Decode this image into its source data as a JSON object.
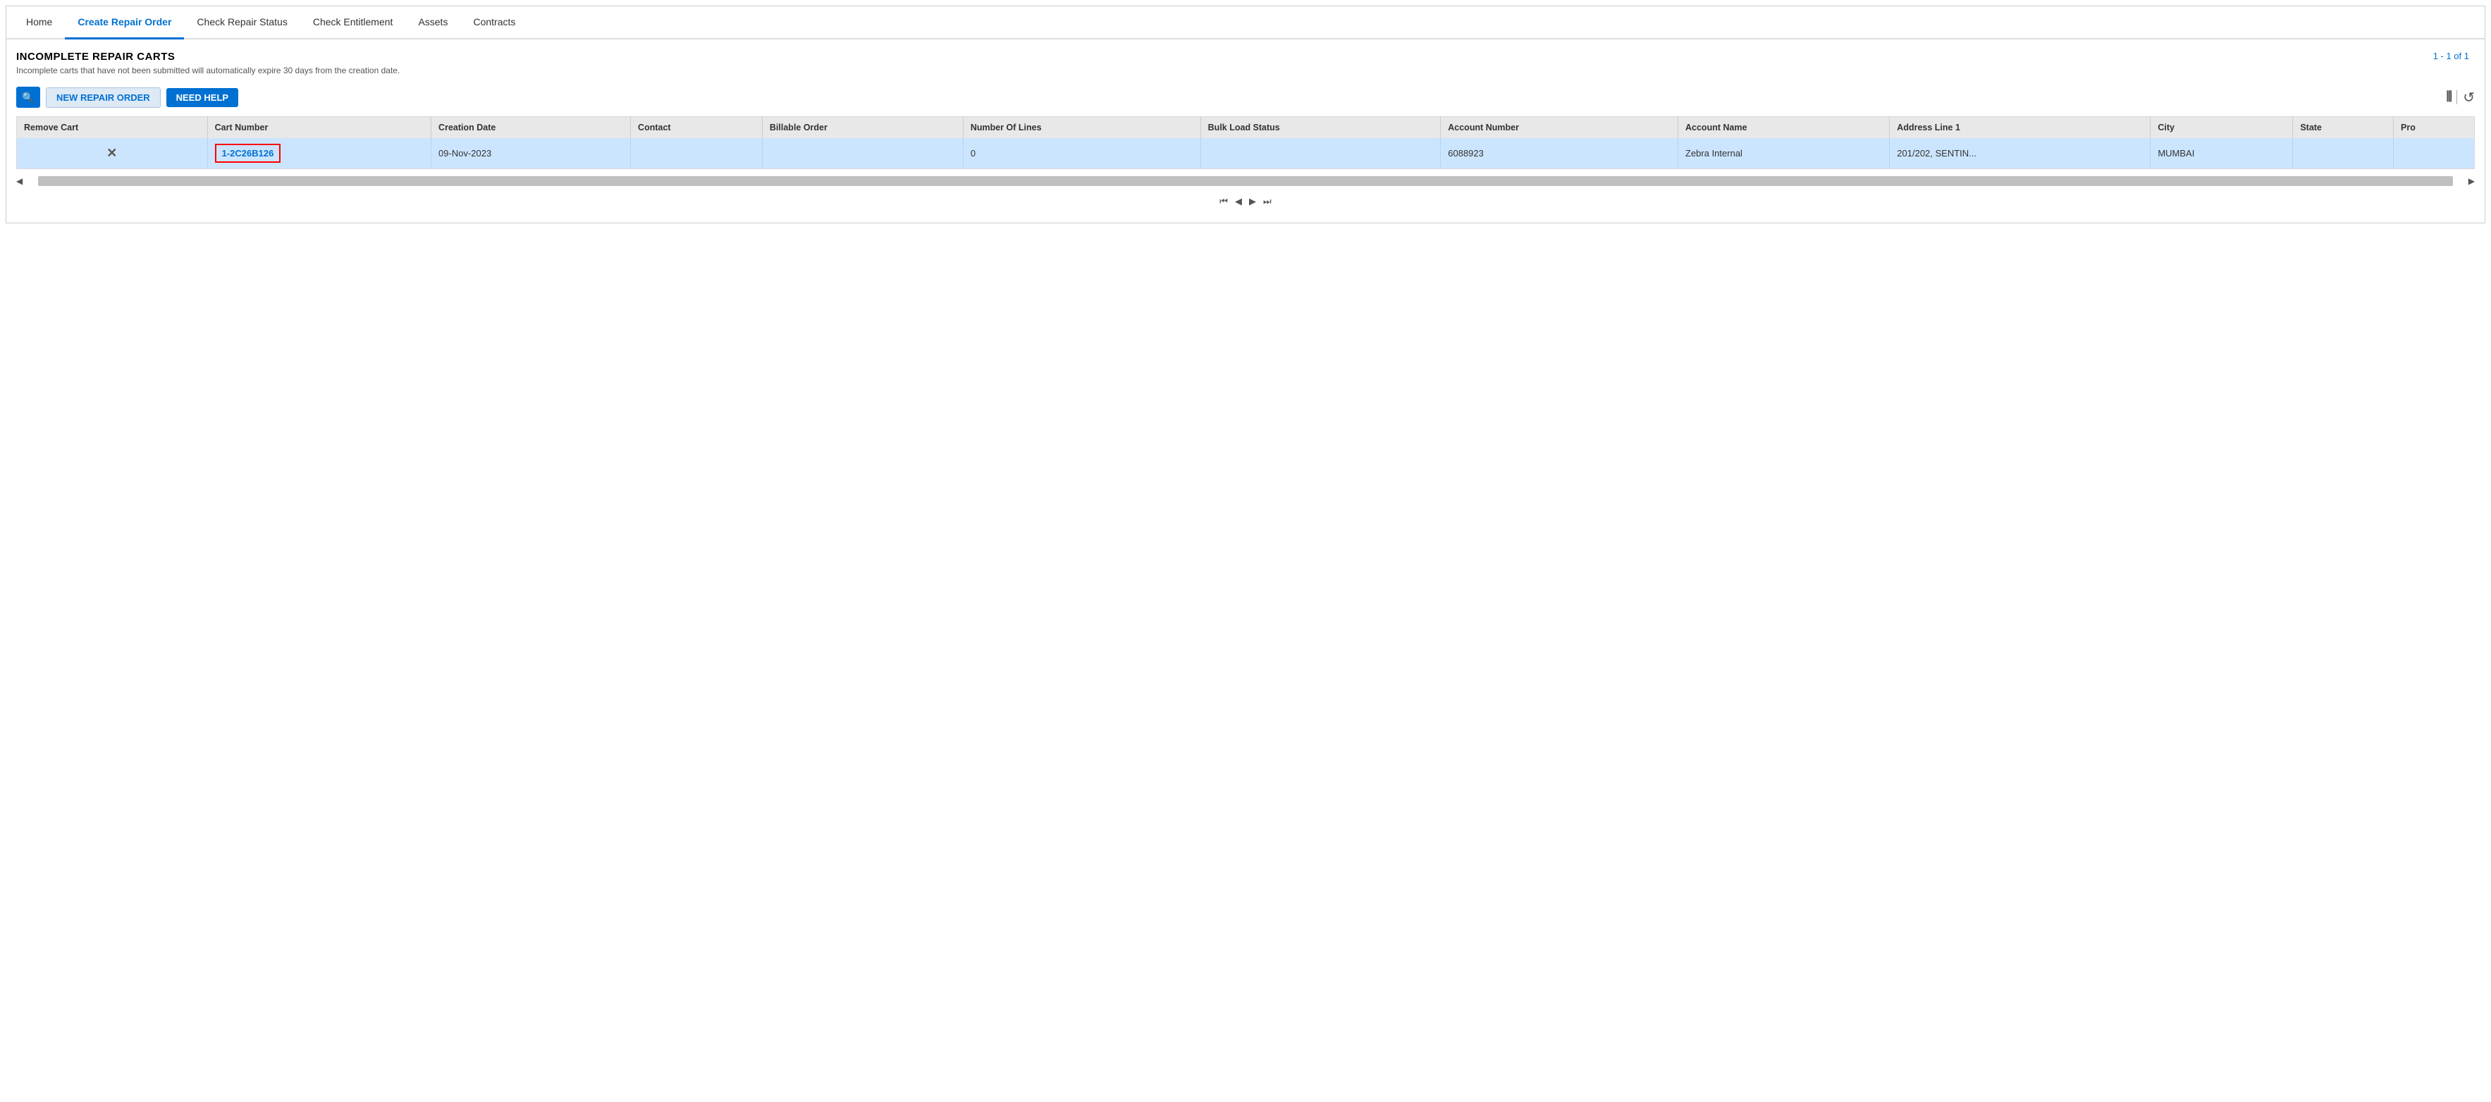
{
  "nav": {
    "items": [
      {
        "id": "home",
        "label": "Home",
        "active": false
      },
      {
        "id": "create-repair-order",
        "label": "Create Repair Order",
        "active": true
      },
      {
        "id": "check-repair-status",
        "label": "Check Repair Status",
        "active": false
      },
      {
        "id": "check-entitlement",
        "label": "Check Entitlement",
        "active": false
      },
      {
        "id": "assets",
        "label": "Assets",
        "active": false
      },
      {
        "id": "contracts",
        "label": "Contracts",
        "active": false
      }
    ]
  },
  "section": {
    "title": "INCOMPLETE REPAIR CARTS",
    "subtitle": "Incomplete carts that have not been submitted will automatically expire 30 days from the creation date.",
    "pagination": "1 - 1 of 1"
  },
  "toolbar": {
    "new_repair_label": "NEW REPAIR ORDER",
    "need_help_label": "NEED HELP"
  },
  "table": {
    "headers": [
      "Remove Cart",
      "Cart Number",
      "Creation Date",
      "Contact",
      "Billable Order",
      "Number Of Lines",
      "Bulk Load Status",
      "Account Number",
      "Account Name",
      "Address Line 1",
      "City",
      "State",
      "Pro"
    ],
    "rows": [
      {
        "remove": "×",
        "cart_number": "1-2C26B126",
        "creation_date": "09-Nov-2023",
        "contact": "",
        "billable_order": "",
        "number_of_lines": "0",
        "bulk_load_status": "",
        "account_number": "6088923",
        "account_name": "Zebra Internal",
        "address_line1": "201/202, SENTIN...",
        "city": "MUMBAI",
        "state": "",
        "pro": ""
      }
    ]
  },
  "pagination_controls": {
    "first": "⏮",
    "prev": "◀",
    "next": "▶",
    "last": "⏭"
  },
  "icons": {
    "search": "🔍",
    "columns": "⦀",
    "refresh": "↺",
    "scroll_left": "◀",
    "scroll_right": "▶"
  }
}
